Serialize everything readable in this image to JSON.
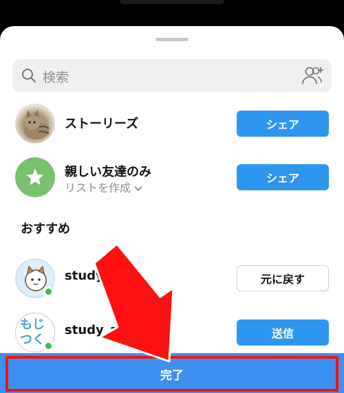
{
  "search": {
    "placeholder": "検索"
  },
  "rows": [
    {
      "name": "ストーリーズ",
      "button": "シェア"
    },
    {
      "name": "親しい友達のみ",
      "sub": "リストを作成",
      "button": "シェア"
    }
  ],
  "section_title": "おすすめ",
  "suggestions": [
    {
      "name": "study.",
      "button": "元に戻す"
    },
    {
      "name": "study_ap",
      "button": "送信"
    }
  ],
  "moji_avatar_text": "もじ つく",
  "done_label": "完了",
  "colors": {
    "primary_blue": "#2f96f0",
    "done_bar": "#3d8ff0",
    "highlight_red": "#ff1010",
    "online_green": "#3dbb4d"
  }
}
